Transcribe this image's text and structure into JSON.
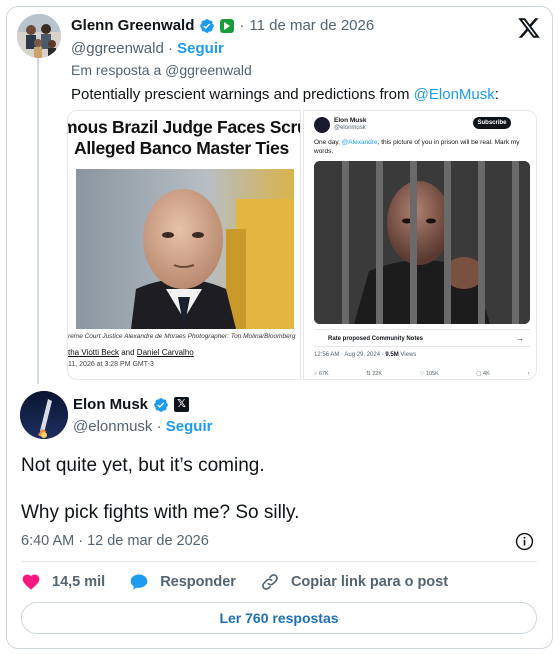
{
  "colors": {
    "accent": "#1d9bf0",
    "like": "#f91880",
    "border": "#cfd9de",
    "muted": "#536471"
  },
  "quoted": {
    "author_name": "Glenn Greenwald",
    "date": "11 de mar de 2026",
    "handle": "@ggreenwald",
    "follow": "Seguir",
    "reply_to": "Em resposta a @ggreenwald",
    "text_prefix": "Potentially prescient warnings and predictions from ",
    "text_mention": "@ElonMusk",
    "text_suffix": ":",
    "icons": [
      "verified-icon",
      "subscription-badge-icon",
      "x-logo-icon"
    ],
    "image_left": {
      "headline_line1": "mous Brazil Judge Faces Scru",
      "headline_line2": "Alleged Banco Master Ties",
      "caption": "reme Court Justice Alexandre de Moraes Photographer: Ton Molina/Bloomberg",
      "byline_prefix": "tha Viotti Beck",
      "byline_and": " and ",
      "byline_author2": "Daniel Carvalho",
      "dateline": "11, 2026 at 3:28 PM GMT-3"
    },
    "image_right": {
      "name": "Elon Musk",
      "handle": "@elonmusk",
      "subscribe": "Subscribe",
      "text_prefix": "One day, ",
      "text_mention": "@Alexandre",
      "text_suffix": ", this picture of you in prison will be real. Mark my words.",
      "notes": "Rate proposed Community Notes",
      "meta_time": "12:56 AM · Aug 29, 2024 · ",
      "meta_views": "9.5M",
      "meta_views_label": " Views",
      "stats": [
        "67K",
        "22K",
        "105K",
        "4K",
        ""
      ]
    }
  },
  "tweet": {
    "author_name": "Elon Musk",
    "handle": "@elonmusk",
    "follow": "Seguir",
    "line1": "Not quite yet, but it’s coming.",
    "line2": "Why pick fights with me? So silly.",
    "timestamp": "6:40 AM · 12 de mar de 2026",
    "icons": [
      "verified-icon",
      "x-affiliate-badge-icon",
      "info-icon"
    ]
  },
  "actions": {
    "likes": "14,5 mil",
    "reply": "Responder",
    "copy_link": "Copiar link para o post",
    "icons": [
      "heart-icon",
      "reply-icon",
      "link-icon"
    ]
  },
  "read_replies": "Ler 760 respostas"
}
